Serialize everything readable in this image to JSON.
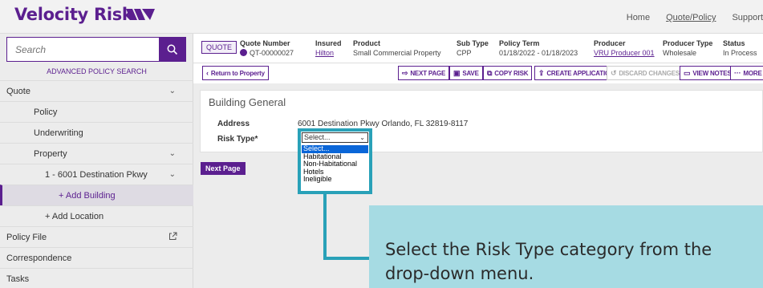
{
  "app": {
    "logo_text": "Velocity Risk"
  },
  "topnav": {
    "items": [
      "Home",
      "Quote/Policy",
      "Support"
    ]
  },
  "sidebar": {
    "search_placeholder": "Search",
    "advanced_search": "ADVANCED POLICY SEARCH",
    "items": [
      {
        "label": "Quote"
      },
      {
        "label": "Policy"
      },
      {
        "label": "Underwriting"
      },
      {
        "label": "Property"
      },
      {
        "label": "1 - 6001 Destination Pkwy"
      },
      {
        "label": "+ Add Building"
      },
      {
        "label": "+ Add Location"
      },
      {
        "label": "Policy File"
      },
      {
        "label": "Correspondence"
      },
      {
        "label": "Tasks"
      }
    ]
  },
  "quote": {
    "badge": "QUOTE",
    "fields": [
      {
        "label": "Quote Number",
        "value": "QT-00000027"
      },
      {
        "label": "Insured",
        "value": "Hilton"
      },
      {
        "label": "Product",
        "value": "Small Commercial Property"
      },
      {
        "label": "Sub Type",
        "value": "CPP"
      },
      {
        "label": "Policy Term",
        "value": "01/18/2022 - 01/18/2023"
      },
      {
        "label": "Producer",
        "value": "VRU Producer 001"
      },
      {
        "label": "Producer Type",
        "value": "Wholesale"
      },
      {
        "label": "Status",
        "value": "In Process"
      }
    ]
  },
  "toolbar": {
    "return": "Return to Property",
    "next_page": "NEXT PAGE",
    "save": "SAVE",
    "copy_risk": "COPY RISK",
    "create_application": "CREATE APPLICATION",
    "discard_changes": "DISCARD CHANGES",
    "view_notes": "VIEW NOTES",
    "more": "MORE"
  },
  "building": {
    "title": "Building General",
    "address_label": "Address",
    "address_value": "6001 Destination Pkwy Orlando, FL 32819-8117",
    "risk_type_label": "Risk Type*",
    "risk_type_value": "Select...",
    "risk_type_options": [
      "Select...",
      "Habitational",
      "Non-Habitational",
      "Hotels",
      "Ineligible"
    ],
    "next_page_button": "Next Page"
  },
  "callout": {
    "text": "Select the Risk Type category from the drop-down menu."
  },
  "colors": {
    "brand": "#5b1f8f",
    "callout_border": "#29a1b8",
    "callout_bg": "#a6dbe3",
    "selected_option": "#0a66d8"
  }
}
